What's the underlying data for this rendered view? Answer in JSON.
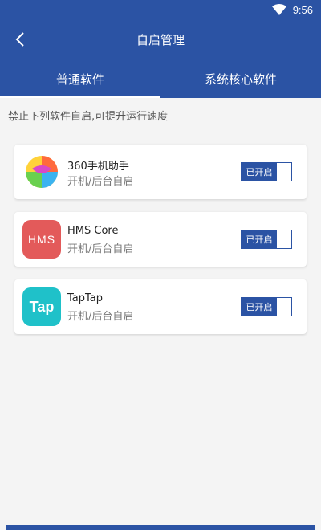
{
  "status": {
    "time": "9:56"
  },
  "header": {
    "title": "自启管理"
  },
  "tabs": [
    {
      "label": "普通软件",
      "active": true
    },
    {
      "label": "系统核心软件",
      "active": false
    }
  ],
  "hint": "禁止下列软件自启,可提升运行速度",
  "apps": [
    {
      "name": "360手机助手",
      "sub": "开机/后台自启",
      "toggle_label": "已开启",
      "icon": "360-assistant-icon"
    },
    {
      "name": "HMS Core",
      "sub": "开机/后台自启",
      "toggle_label": "已开启",
      "icon": "hms-core-icon",
      "icon_text": "HMS"
    },
    {
      "name": "TapTap",
      "sub": "开机/后台自启",
      "toggle_label": "已开启",
      "icon": "taptap-icon",
      "icon_text": "Tap"
    }
  ],
  "colors": {
    "primary": "#2b53a4",
    "hms": "#e35a5a",
    "taptap": "#1fc1c9"
  }
}
